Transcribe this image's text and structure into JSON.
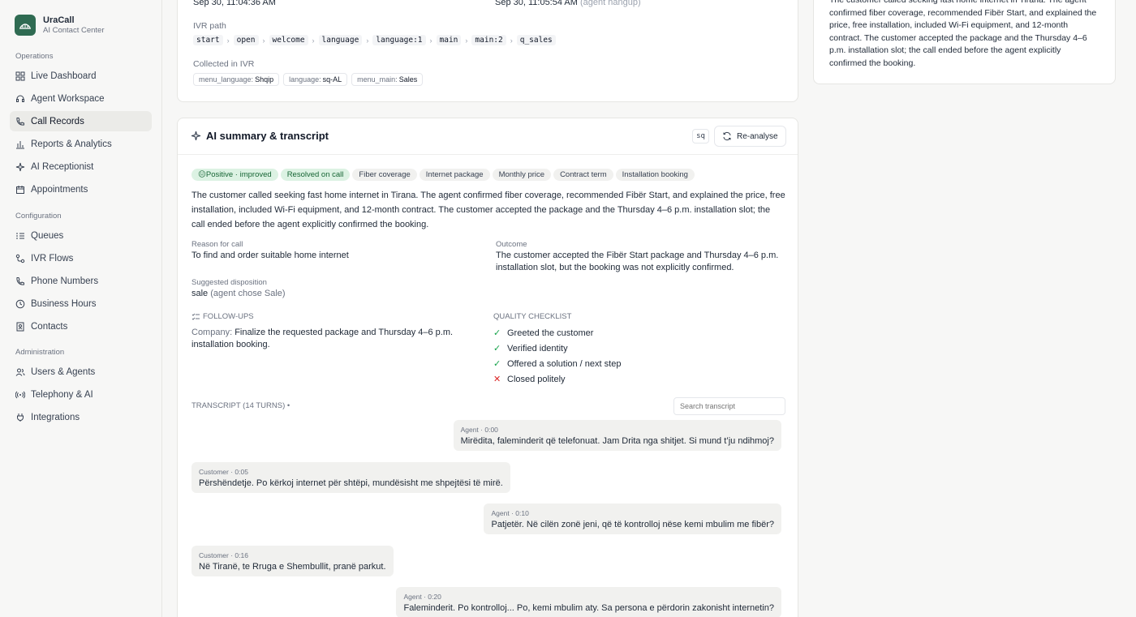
{
  "brand": {
    "name": "UraCall",
    "subtitle": "AI Contact Center"
  },
  "sidebar": {
    "sections": [
      {
        "title": "Operations",
        "items": [
          {
            "label": "Live Dashboard",
            "icon": "grid-icon"
          },
          {
            "label": "Agent Workspace",
            "icon": "headset-icon"
          },
          {
            "label": "Call Records",
            "icon": "phone-icon",
            "active": true
          },
          {
            "label": "Reports & Analytics",
            "icon": "bar-chart-icon"
          },
          {
            "label": "AI Receptionist",
            "icon": "sparkle-icon"
          },
          {
            "label": "Appointments",
            "icon": "calendar-icon"
          }
        ]
      },
      {
        "title": "Configuration",
        "items": [
          {
            "label": "Queues",
            "icon": "list-icon"
          },
          {
            "label": "IVR Flows",
            "icon": "flow-icon"
          },
          {
            "label": "Phone Numbers",
            "icon": "phone-icon"
          },
          {
            "label": "Business Hours",
            "icon": "clock-icon"
          },
          {
            "label": "Contacts",
            "icon": "contact-card-icon"
          }
        ]
      },
      {
        "title": "Administration",
        "items": [
          {
            "label": "Users & Agents",
            "icon": "users-icon"
          },
          {
            "label": "Telephony & AI",
            "icon": "antenna-icon"
          },
          {
            "label": "Integrations",
            "icon": "plug-icon"
          }
        ]
      }
    ]
  },
  "call_info": {
    "start_time": "Sep 30, 11:04:36 AM",
    "end_time": "Sep 30, 11:05:54 AM",
    "end_reason": "(agent hangup)",
    "ivr_path_label": "IVR path",
    "ivr_path": [
      "start",
      "open",
      "welcome",
      "language",
      "language:1",
      "main",
      "main:2",
      "q_sales"
    ],
    "collected_label": "Collected in IVR",
    "collected": [
      {
        "key": "menu_language:",
        "value": "Shqip"
      },
      {
        "key": "language:",
        "value": "sq-AL"
      },
      {
        "key": "menu_main:",
        "value": "Sales"
      }
    ]
  },
  "right_summary": "The customer called seeking fast home internet in Tirana. The agent confirmed fiber coverage, recommended Fibër Start, and explained the price, free installation, included Wi-Fi equipment, and 12-month contract. The customer accepted the package and the Thursday 4–6 p.m. installation slot; the call ended before the agent explicitly confirmed the booking.",
  "ai": {
    "title": "AI summary & transcript",
    "lang_badge": "sq",
    "reanalyse_label": "Re-analyse",
    "tags": [
      {
        "label": "😐Positive · improved",
        "tone": "green"
      },
      {
        "label": "Resolved on call",
        "tone": "green"
      },
      {
        "label": "Fiber coverage",
        "tone": "gray"
      },
      {
        "label": "Internet package",
        "tone": "gray"
      },
      {
        "label": "Monthly price",
        "tone": "gray"
      },
      {
        "label": "Contract term",
        "tone": "gray"
      },
      {
        "label": "Installation booking",
        "tone": "gray"
      }
    ],
    "summary": "The customer called seeking fast home internet in Tirana. The agent confirmed fiber coverage, recommended Fibër Start, and explained the price, free installation, included Wi-Fi equipment, and 12-month contract. The customer accepted the package and the Thursday 4–6 p.m. installation slot; the call ended before the agent explicitly confirmed the booking.",
    "reason_label": "Reason for call",
    "reason": "To find and order suitable home internet",
    "outcome_label": "Outcome",
    "outcome": "The customer accepted the Fibër Start package and Thursday 4–6 p.m. installation slot, but the booking was not explicitly confirmed.",
    "disposition_label": "Suggested disposition",
    "disposition": "sale",
    "disposition_note": "(agent chose Sale)",
    "followups_label": "FOLLOW-UPS",
    "followup_party": "Company:",
    "followup_text": "Finalize the requested package and Thursday 4–6 p.m. installation booking.",
    "quality_label": "QUALITY CHECKLIST",
    "checklist": [
      {
        "label": "Greeted the customer",
        "ok": true
      },
      {
        "label": "Verified identity",
        "ok": true
      },
      {
        "label": "Offered a solution / next step",
        "ok": true
      },
      {
        "label": "Closed politely",
        "ok": false
      }
    ],
    "transcript_label": "TRANSCRIPT (14 TURNS) •",
    "search_placeholder": "Search transcript",
    "turns": [
      {
        "speaker": "Agent",
        "time": "0:00",
        "text": "Mirëdita, faleminderit që telefonuat. Jam Drita nga shitjet. Si mund t’ju ndihmoj?"
      },
      {
        "speaker": "Customer",
        "time": "0:05",
        "text": "Përshëndetje. Po kërkoj internet për shtëpi, mundësisht me shpejtësi të mirë."
      },
      {
        "speaker": "Agent",
        "time": "0:10",
        "text": "Patjetër. Në cilën zonë jeni, që të kontrolloj nëse kemi mbulim me fibër?"
      },
      {
        "speaker": "Customer",
        "time": "0:16",
        "text": "Në Tiranë, te Rruga e Shembullit, pranë parkut."
      },
      {
        "speaker": "Agent",
        "time": "0:20",
        "text": "Faleminderit. Po kontrolloj... Po, kemi mbulim aty. Sa persona e përdorin zakonisht internetin?"
      }
    ]
  },
  "colors": {
    "accent": "#2f6b52",
    "bubble": "#f1f1ef",
    "positive": "#dcf2e3",
    "fail": "#dc2626",
    "ok": "#16a34a"
  }
}
